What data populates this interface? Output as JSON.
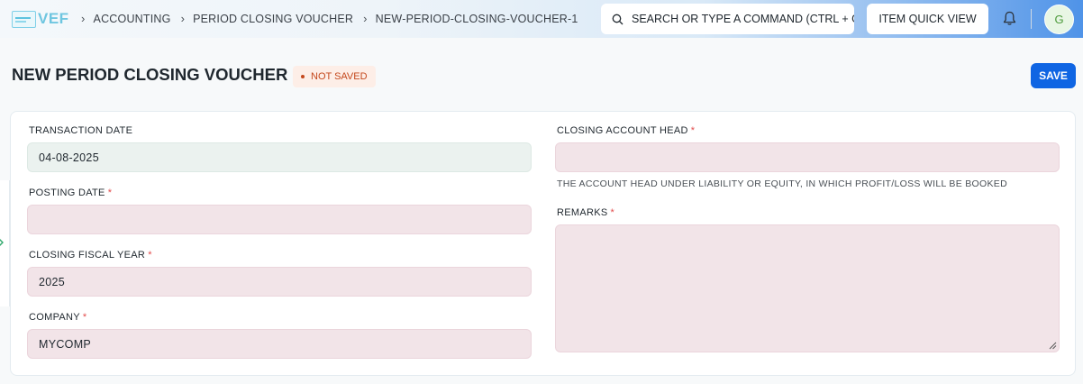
{
  "app": {
    "logo_text": "VEF"
  },
  "breadcrumb": {
    "items": [
      "ACCOUNTING",
      "PERIOD CLOSING VOUCHER",
      "NEW-PERIOD-CLOSING-VOUCHER-1"
    ]
  },
  "search": {
    "placeholder": "SEARCH OR TYPE A COMMAND (CTRL + G)"
  },
  "navbar": {
    "quick_view_label": "ITEM QUICK VIEW",
    "avatar_initial": "G"
  },
  "page": {
    "title": "NEW PERIOD CLOSING VOUCHER",
    "status": "NOT SAVED",
    "save_label": "SAVE"
  },
  "form": {
    "transaction_date": {
      "label": "TRANSACTION DATE",
      "value": "04-08-2025"
    },
    "posting_date": {
      "label": "POSTING DATE",
      "required": "*",
      "value": ""
    },
    "closing_fiscal_year": {
      "label": "CLOSING FISCAL YEAR",
      "required": "*",
      "value": "2025"
    },
    "company": {
      "label": "COMPANY",
      "required": "*",
      "value": "MYCOMP"
    },
    "closing_account_head": {
      "label": "CLOSING ACCOUNT HEAD",
      "required": "*",
      "value": "",
      "help": "THE ACCOUNT HEAD UNDER LIABILITY OR EQUITY, IN WHICH PROFIT/LOSS WILL BE BOOKED"
    },
    "remarks": {
      "label": "REMARKS",
      "required": "*",
      "value": ""
    }
  },
  "colors": {
    "primary": "#0f65e3",
    "required_input_bg": "#f2e4e8",
    "filled_input_bg": "#ebf2ef",
    "status_text": "#c4481c",
    "status_bg": "#fdeee7"
  }
}
